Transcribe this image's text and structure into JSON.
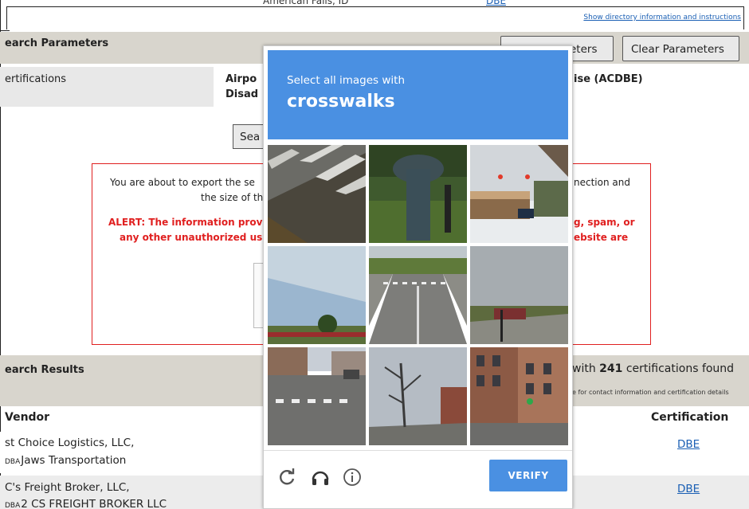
{
  "top": {
    "truncated_city": "American Falls, ID",
    "truncated_link": "DBE",
    "directory_link": "Show directory information and instructions"
  },
  "search_params": {
    "title": "earch Parameters",
    "btn_hidden": "eters",
    "btn_clear": "Clear Parameters",
    "cert_label": "ertifications",
    "cert_value_1": "Airpo",
    "cert_value_2": "Disad",
    "cert_value_3": "ise (ACDBE)",
    "search_btn": "Sea"
  },
  "export": {
    "line1_left": "You are about to export the se",
    "line2_left": "the size of the e",
    "line1_right": "nection and",
    "alert1_left": "ALERT: The information prov",
    "alert2_left": "any other unauthorized us",
    "alert1_right": "g, spam, or",
    "alert2_right": "ebsite are"
  },
  "results": {
    "title": "earch Results",
    "count_prefix": "with ",
    "count_value": "241",
    "count_suffix": " certifications found",
    "note": "e for contact information and certification details",
    "col_vendor": "Vendor",
    "col_cert": "Certification",
    "rows": [
      {
        "name": "st Choice Logistics, LLC,",
        "dba_tag": "DBA",
        "dba": "Jaws Transportation",
        "cert": "DBE"
      },
      {
        "name": "C's Freight Broker, LLC,",
        "dba_tag": "DBA",
        "dba": "2 CS FREIGHT BROKER LLC",
        "cert": "DBE"
      }
    ]
  },
  "captcha": {
    "subtitle": "Select all images with",
    "object": "crosswalks",
    "verify_label": "VERIFY",
    "icons": [
      "reload-icon",
      "audio-icon",
      "info-icon"
    ],
    "accent": "#4a90e2"
  }
}
